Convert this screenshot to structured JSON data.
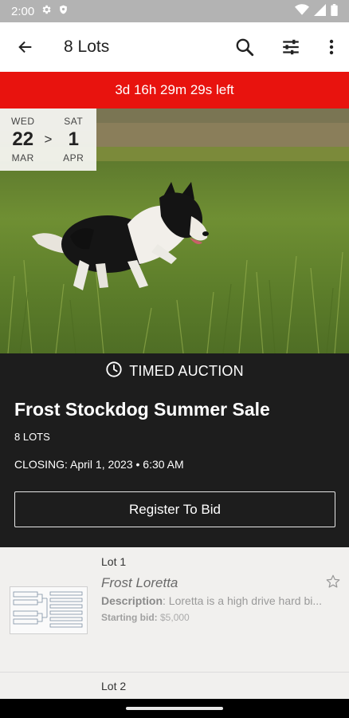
{
  "status_bar": {
    "time": "2:00",
    "icons": [
      "gear-icon",
      "shield-icon",
      "wifi-icon",
      "signal-icon",
      "battery-icon"
    ]
  },
  "app_bar": {
    "title": "8 Lots",
    "icons": [
      "back-arrow-icon",
      "search-icon",
      "filter-icon",
      "more-vert-icon"
    ]
  },
  "countdown": {
    "text": "3d 16h 29m 29s left",
    "color": "#e8130e"
  },
  "date_range": {
    "start": {
      "dow": "WED",
      "day": "22",
      "month": "MAR"
    },
    "separator": ">",
    "end": {
      "dow": "SAT",
      "day": "1",
      "month": "APR"
    }
  },
  "auction": {
    "type_label": "TIMED AUCTION",
    "title": "Frost Stockdog Summer Sale",
    "lots_count": "8 LOTS",
    "closing": "CLOSING: April 1, 2023 • 6:30 AM",
    "register_label": "Register To Bid"
  },
  "lots": [
    {
      "number": "Lot 1",
      "name": "Frost Loretta",
      "description_label": "Description",
      "description": ": Loretta is a high drive hard bi...",
      "starting_bid_label": "Starting bid:",
      "starting_bid": " $5,000",
      "favorite_icon": "star-outline-icon"
    },
    {
      "number": "Lot 2"
    }
  ],
  "colors": {
    "accent": "#e8130e",
    "info_bg": "#1d1d1d",
    "list_bg": "#f1f0ee"
  }
}
